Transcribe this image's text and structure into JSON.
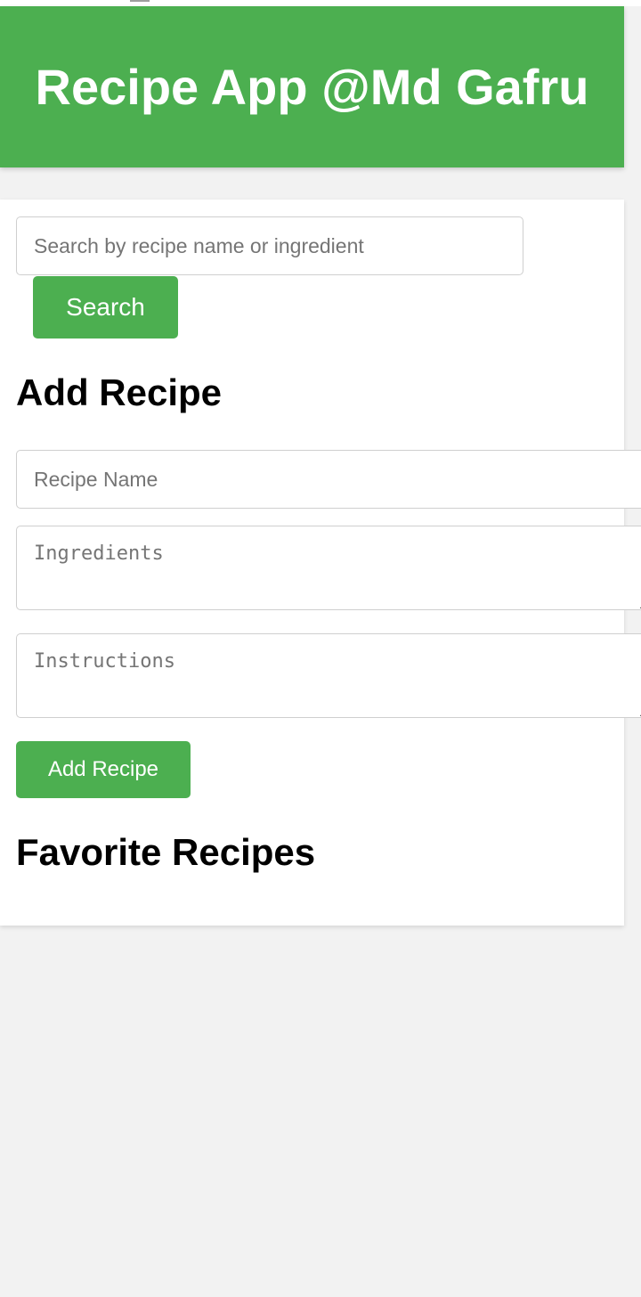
{
  "header": {
    "title": "Recipe App @Md Gafru"
  },
  "search": {
    "placeholder": "Search by recipe name or ingredient",
    "value": "",
    "button_label": "Search"
  },
  "add_recipe": {
    "heading": "Add Recipe",
    "name_placeholder": "Recipe Name",
    "ingredients_placeholder": "Ingredients",
    "instructions_placeholder": "Instructions",
    "button_label": "Add Recipe"
  },
  "favorites": {
    "heading": "Favorite Recipes",
    "items": []
  },
  "colors": {
    "accent": "#4caf50",
    "background": "#f2f2f2",
    "card": "#ffffff"
  }
}
